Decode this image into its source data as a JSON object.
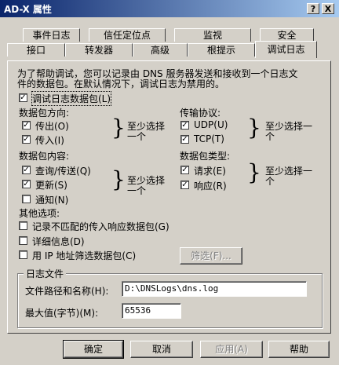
{
  "window": {
    "title": "AD-X 属性",
    "help_btn": "?",
    "close_btn": "X"
  },
  "tabs_row1": [
    "事件日志",
    "信任定位点",
    "监视",
    "安全"
  ],
  "tabs_row2": [
    "接口",
    "转发器",
    "高级",
    "根提示",
    "调试日志"
  ],
  "description": "为了帮助调试，您可以记录由 DNS 服务器发送和接收到一个日志文件的数据包。在默认情况下，调试日志为禁用的。",
  "description_line1": "为了帮助调试，您可以记录由 DNS 服务器发送和接收到一个日志文",
  "description_line2": "件的数据包。在默认情况下，调试日志为禁用的。",
  "log_packets": {
    "label": "调试日志数据包(L)",
    "checked": true
  },
  "direction": {
    "heading": "数据包方向:",
    "outgoing": {
      "label": "传出(O)",
      "checked": true
    },
    "incoming": {
      "label": "传入(I)",
      "checked": true
    },
    "note_line1": "至少选择",
    "note_line2": "一个"
  },
  "protocol": {
    "heading": "传输协议:",
    "udp": {
      "label": "UDP(U)",
      "checked": true
    },
    "tcp": {
      "label": "TCP(T)",
      "checked": true
    },
    "note_line1": "至少选择一",
    "note_line2": "个"
  },
  "contents": {
    "heading": "数据包内容:",
    "query": {
      "label": "查询/传送(Q)",
      "checked": true
    },
    "update": {
      "label": "更新(S)",
      "checked": true
    },
    "notify": {
      "label": "通知(N)",
      "checked": false
    },
    "note_line1": "至少选择",
    "note_line2": "一个"
  },
  "packet_type": {
    "heading": "数据包类型:",
    "request": {
      "label": "请求(E)",
      "checked": true
    },
    "response": {
      "label": "响应(R)",
      "checked": true
    },
    "note_line1": "至少选择一",
    "note_line2": "个"
  },
  "other": {
    "heading": "其他选项:",
    "unmatched": {
      "label": "记录不匹配的传入响应数据包(G)",
      "checked": false
    },
    "details": {
      "label": "详细信息(D)",
      "checked": false
    },
    "filter_ip": {
      "label": "用 IP 地址筛选数据包(C)",
      "checked": false
    },
    "filter_button": "筛选(F)..."
  },
  "log_file": {
    "heading": "日志文件",
    "path_label": "文件路径和名称(H):",
    "path_value": "D:\\DNSLogs\\dns.log",
    "max_label": "最大值(字节)(M):",
    "max_value": "65536"
  },
  "buttons": {
    "ok": "确定",
    "cancel": "取消",
    "apply": "应用(A)",
    "help": "帮助"
  },
  "check_mark": "✓"
}
